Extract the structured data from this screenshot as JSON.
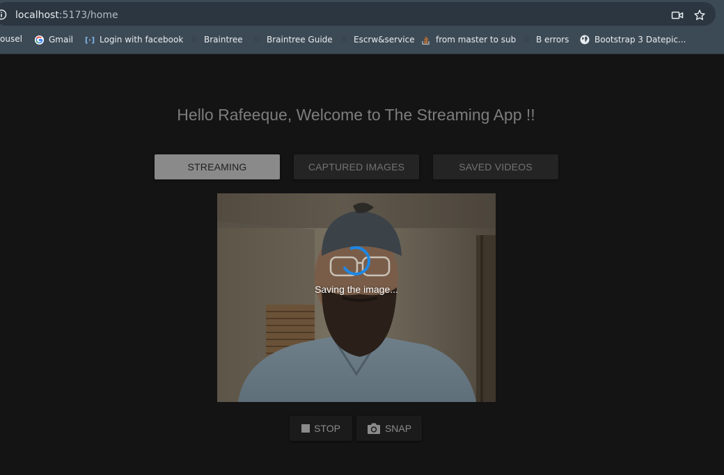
{
  "browser": {
    "url_host": "localhost",
    "url_path": ":5173/home",
    "bookmarks": [
      {
        "label": "ousel",
        "icon": "carousel-favicon"
      },
      {
        "label": "Gmail",
        "icon": "google-icon"
      },
      {
        "label": "Login with facebook",
        "icon": "code-bracket-icon"
      },
      {
        "label": "Braintree",
        "icon": "braintree-icon"
      },
      {
        "label": "Braintree Guide",
        "icon": "braintree-icon"
      },
      {
        "label": "Escrw&service",
        "icon": "braintree-icon"
      },
      {
        "label": "from master to sub",
        "icon": "stackoverflow-icon"
      },
      {
        "label": "B errors",
        "icon": "braintree-icon"
      },
      {
        "label": "Bootstrap 3 Datepic...",
        "icon": "globe-icon"
      }
    ],
    "icons": [
      "site-info-icon",
      "camera-icon",
      "star-icon"
    ]
  },
  "app": {
    "greeting": "Hello Rafeeque, Welcome to The Streaming App !!",
    "tabs": [
      {
        "label": "STREAMING",
        "active": true
      },
      {
        "label": "CAPTURED IMAGES",
        "active": false
      },
      {
        "label": "SAVED VIDEOS",
        "active": false
      }
    ],
    "status_text": "Saving the image...",
    "controls": {
      "stop_label": "STOP",
      "snap_label": "SNAP"
    }
  },
  "colors": {
    "background": "#141414",
    "spinner": "#1e88e5",
    "tab_active": "#8a8a8a",
    "tab_inactive": "#242424"
  }
}
